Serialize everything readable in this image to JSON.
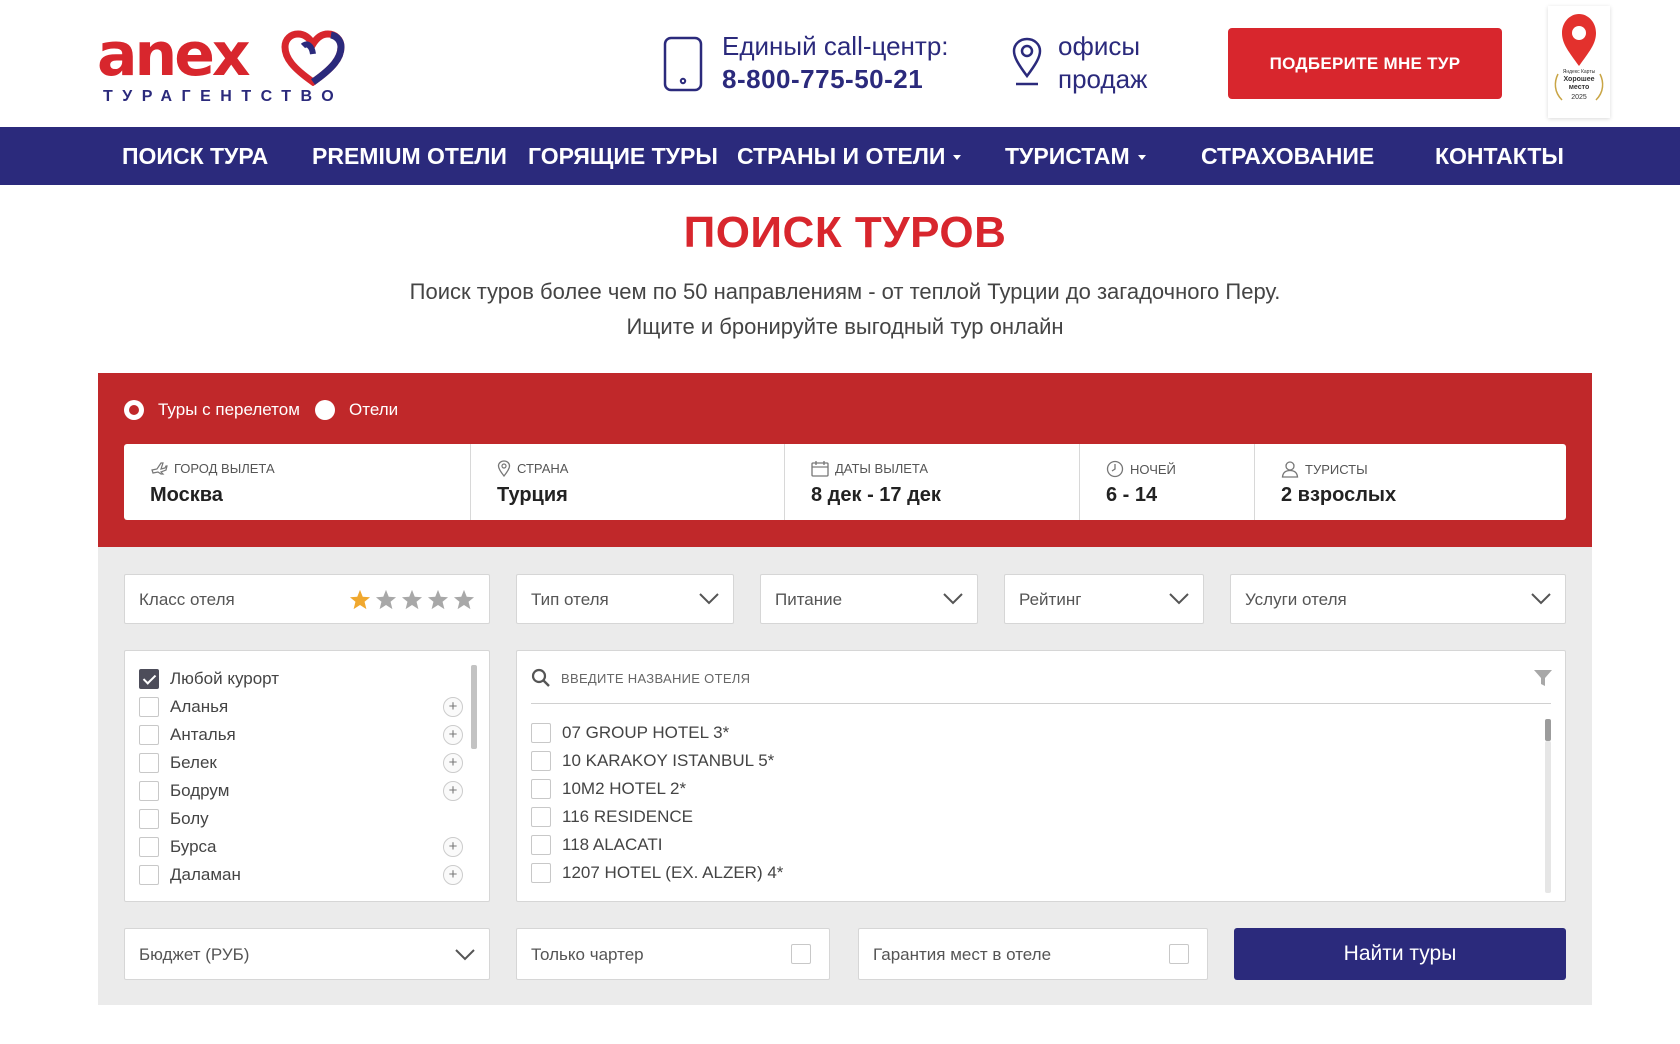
{
  "header": {
    "logo_word": "anex",
    "logo_sub": "ТУРАГЕНТСТВО",
    "callcenter_label": "Единый call-центр:",
    "phone": "8-800-775-50-21",
    "offices_line1": "офисы",
    "offices_line2": "продаж",
    "cta": "ПОДБЕРИТЕ МНЕ ТУР",
    "badge_line1": "Яндекс Карты",
    "badge_line2": "Хорошее",
    "badge_line3": "место",
    "badge_year": "2025"
  },
  "nav": [
    {
      "label": "ПОИСК ТУРА"
    },
    {
      "label": "PREMIUM ОТЕЛИ"
    },
    {
      "label": "ГОРЯЩИЕ ТУРЫ"
    },
    {
      "label": "СТРАНЫ И ОТЕЛИ"
    },
    {
      "label": "ТУРИСТАМ"
    },
    {
      "label": "СТРАХОВАНИЕ"
    },
    {
      "label": "КОНТАКТЫ"
    }
  ],
  "page": {
    "title": "ПОИСК ТУРОВ",
    "subtitle1": "Поиск туров более чем по 50 направлениям - от теплой Турции до загадочного Перу.",
    "subtitle2": "Ищите и бронируйте выгодный тур онлайн"
  },
  "search": {
    "mode_tours": "Туры с перелетом",
    "mode_hotels": "Отели",
    "mode_selected": "tours",
    "fields": {
      "departure_label": "ГОРОД ВЫЛЕТА",
      "departure_value": "Москва",
      "country_label": "СТРАНА",
      "country_value": "Турция",
      "dates_label": "ДАТЫ ВЫЛЕТА",
      "dates_value": "8 дек - 17 дек",
      "nights_label": "НОЧЕЙ",
      "nights_value": "6 - 14",
      "tourists_label": "ТУРИСТЫ",
      "tourists_value": "2 взрослых"
    }
  },
  "filters": {
    "hotel_class": "Класс отеля",
    "hotel_class_stars": 1,
    "hotel_type": "Тип отеля",
    "meal": "Питание",
    "rating": "Рейтинг",
    "services": "Услуги отеля",
    "budget": "Бюджет (РУБ)",
    "charter_only": "Только чартер",
    "guarantee": "Гарантия мест в отеле",
    "find": "Найти туры"
  },
  "resorts": [
    {
      "name": "Любой курорт",
      "checked": true,
      "expand": false
    },
    {
      "name": "Аланья",
      "checked": false,
      "expand": true
    },
    {
      "name": "Анталья",
      "checked": false,
      "expand": true
    },
    {
      "name": "Белек",
      "checked": false,
      "expand": true
    },
    {
      "name": "Бодрум",
      "checked": false,
      "expand": true
    },
    {
      "name": "Болу",
      "checked": false,
      "expand": false
    },
    {
      "name": "Бурса",
      "checked": false,
      "expand": true
    },
    {
      "name": "Даламан",
      "checked": false,
      "expand": true
    }
  ],
  "hotels": {
    "placeholder": "ВВЕДИТЕ НАЗВАНИЕ ОТЕЛЯ",
    "items": [
      "07 GROUP HOTEL 3*",
      "10 KARAKOY ISTANBUL 5*",
      "10M2 HOTEL 2*",
      "116 RESIDENCE",
      "118 ALACATI",
      "1207 HOTEL (EX. ALZER) 4*"
    ]
  },
  "colors": {
    "brand_red": "#d8262d",
    "brand_blue": "#2b2a7c",
    "panel_red": "#c0282a",
    "panel_grey": "#ebebeb",
    "star_active": "#f0a82e",
    "star_inactive": "#a8a8a8"
  }
}
